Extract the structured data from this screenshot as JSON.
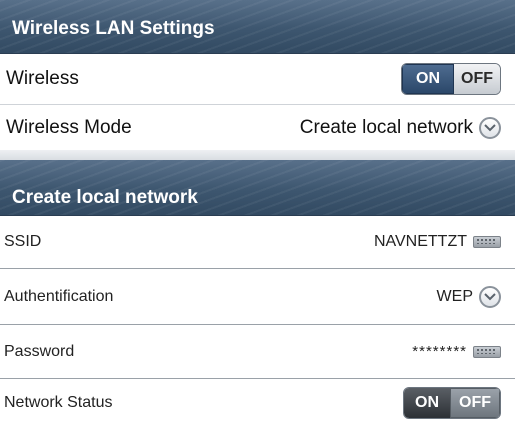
{
  "sections": {
    "wireless_lan_title": "Wireless LAN Settings",
    "local_network_title": "Create local network"
  },
  "wireless": {
    "label": "Wireless",
    "toggle_on": "ON",
    "toggle_off": "OFF",
    "state": "ON"
  },
  "wireless_mode": {
    "label": "Wireless Mode",
    "value": "Create local network",
    "icon": "chevron-down-icon"
  },
  "ssid": {
    "label": "SSID",
    "value": "NAVNETTZT",
    "icon": "keyboard-icon"
  },
  "authentification": {
    "label": "Authentification",
    "value": "WEP",
    "icon": "chevron-down-icon"
  },
  "password": {
    "label": "Password",
    "value": "********",
    "icon": "keyboard-icon"
  },
  "network_status": {
    "label": "Network Status",
    "toggle_on": "ON",
    "toggle_off": "OFF",
    "state": "OFF"
  },
  "colors": {
    "header_bg": "#3d566f",
    "toggle_active_blue": "#2a4668"
  }
}
